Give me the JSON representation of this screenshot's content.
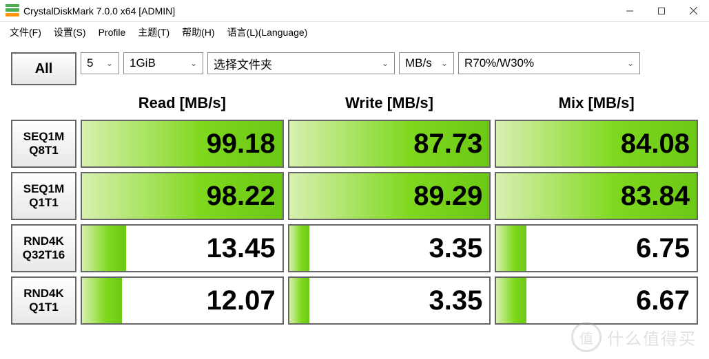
{
  "window": {
    "title": "CrystalDiskMark 7.0.0 x64 [ADMIN]"
  },
  "menu": {
    "file": "文件(F)",
    "settings": "设置(S)",
    "profile": "Profile",
    "theme": "主题(T)",
    "help": "帮助(H)",
    "language": "语言(L)(Language)"
  },
  "toolbar": {
    "all_label": "All",
    "count": "5",
    "size": "1GiB",
    "target": "选择文件夹",
    "unit": "MB/s",
    "mix": "R70%/W30%"
  },
  "columns": {
    "read": "Read [MB/s]",
    "write": "Write [MB/s]",
    "mix": "Mix [MB/s]"
  },
  "tests": [
    {
      "label1": "SEQ1M",
      "label2": "Q8T1",
      "read": "99.18",
      "write": "87.73",
      "mix": "84.08",
      "fill_r": 100,
      "fill_w": 100,
      "fill_m": 100
    },
    {
      "label1": "SEQ1M",
      "label2": "Q1T1",
      "read": "98.22",
      "write": "89.29",
      "mix": "83.84",
      "fill_r": 100,
      "fill_w": 100,
      "fill_m": 100
    },
    {
      "label1": "RND4K",
      "label2": "Q32T16",
      "read": "13.45",
      "write": "3.35",
      "mix": "6.75",
      "fill_r": 22,
      "fill_w": 10,
      "fill_m": 15
    },
    {
      "label1": "RND4K",
      "label2": "Q1T1",
      "read": "12.07",
      "write": "3.35",
      "mix": "6.67",
      "fill_r": 20,
      "fill_w": 10,
      "fill_m": 15
    }
  ],
  "watermark": {
    "icon": "值",
    "text": "什么值得买"
  },
  "colors": {
    "accent_green": "#7FD81E"
  }
}
